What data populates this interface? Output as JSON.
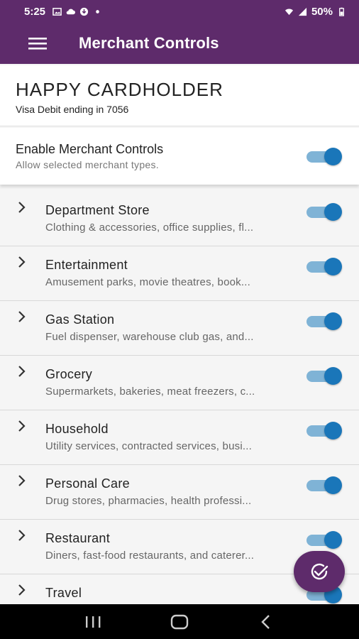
{
  "status_bar": {
    "time": "5:25",
    "battery": "50%"
  },
  "app_bar": {
    "title": "Merchant Controls"
  },
  "card": {
    "holder": "HAPPY CARDHOLDER",
    "subtitle": "Visa Debit ending in 7056"
  },
  "enable": {
    "title": "Enable Merchant Controls",
    "subtitle": "Allow selected merchant types.",
    "on": true
  },
  "merchants": [
    {
      "title": "Department Store",
      "desc": "Clothing & accessories, office supplies, fl...",
      "on": true
    },
    {
      "title": "Entertainment",
      "desc": "Amusement parks, movie theatres, book...",
      "on": true
    },
    {
      "title": "Gas Station",
      "desc": "Fuel dispenser, warehouse club gas, and...",
      "on": true
    },
    {
      "title": "Grocery",
      "desc": "Supermarkets, bakeries, meat freezers, c...",
      "on": true
    },
    {
      "title": "Household",
      "desc": "Utility services, contracted services, busi...",
      "on": true
    },
    {
      "title": "Personal Care",
      "desc": "Drug stores, pharmacies, health professi...",
      "on": true
    },
    {
      "title": "Restaurant",
      "desc": "Diners, fast-food restaurants, and caterer...",
      "on": true
    },
    {
      "title": "Travel",
      "desc": "",
      "on": true
    }
  ],
  "colors": {
    "primary": "#5e2b6b",
    "toggle_thumb": "#1a76b9",
    "toggle_track": "#7fb3d6"
  },
  "icons": {
    "menu": "hamburger-icon",
    "fab": "check-circle-icon",
    "chevron": "chevron-right-icon"
  }
}
